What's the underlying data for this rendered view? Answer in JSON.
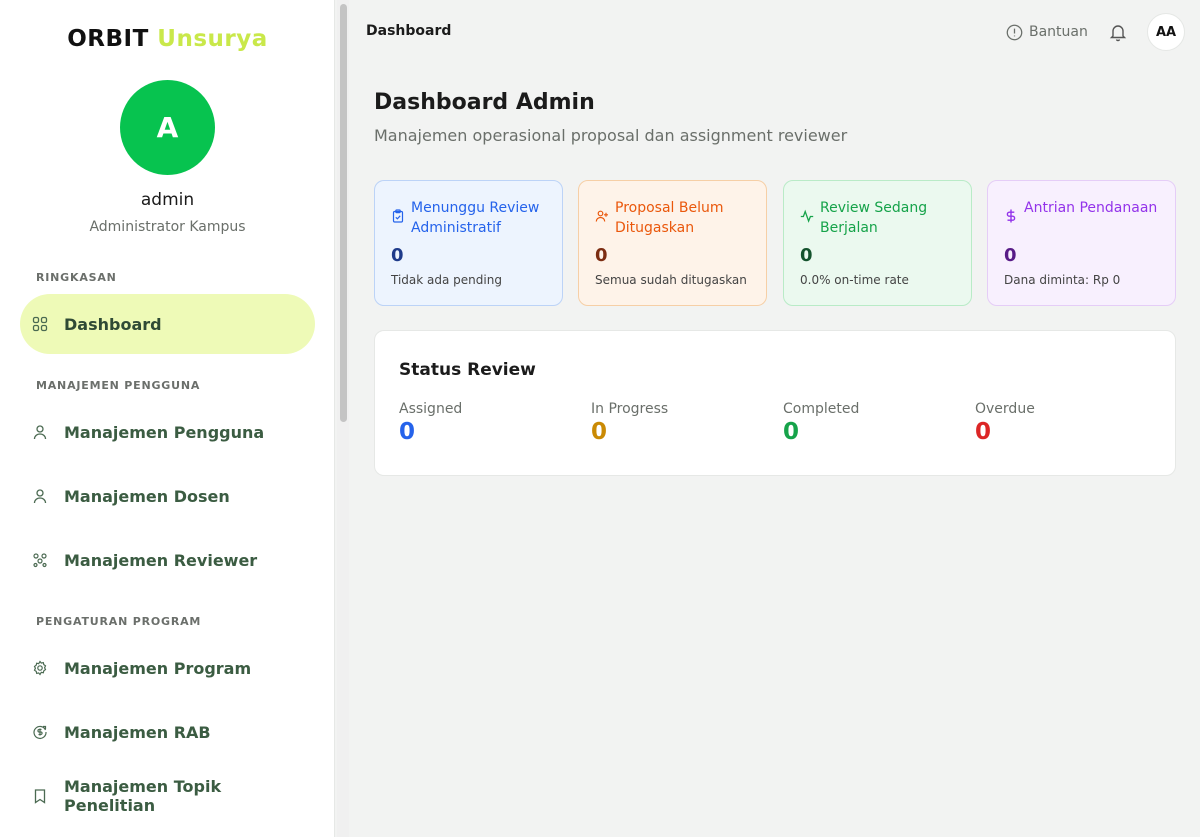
{
  "brand": {
    "part1": "ORBIT",
    "part2": "Unsurya"
  },
  "user": {
    "initial": "A",
    "name": "admin",
    "role": "Administrator Kampus"
  },
  "sidebar": {
    "sections": [
      {
        "label": "RINGKASAN"
      },
      {
        "label": "MANAJEMEN PENGGUNA"
      },
      {
        "label": "PENGATURAN PROGRAM"
      }
    ],
    "items": [
      {
        "label": "Dashboard",
        "icon": "grid-icon",
        "active": true
      },
      {
        "label": "Manajemen Pengguna",
        "icon": "user-icon"
      },
      {
        "label": "Manajemen Dosen",
        "icon": "user-icon"
      },
      {
        "label": "Manajemen Reviewer",
        "icon": "users-network-icon"
      },
      {
        "label": "Manajemen Program",
        "icon": "gear-icon"
      },
      {
        "label": "Manajemen RAB",
        "icon": "money-cycle-icon"
      },
      {
        "label": "Manajemen Topik Penelitian",
        "icon": "bookmark-icon"
      }
    ]
  },
  "topbar": {
    "breadcrumb": "Dashboard",
    "help_label": "Bantuan",
    "user_initials": "AA"
  },
  "main": {
    "title": "Dashboard Admin",
    "subtitle": "Manajemen operasional proposal dan assignment reviewer"
  },
  "cards": [
    {
      "title": "Menunggu Review Administratif",
      "value": "0",
      "desc": "Tidak ada pending",
      "icon": "clipboard-check-icon",
      "color": "#2563eb"
    },
    {
      "title": "Proposal Belum Ditugaskan",
      "value": "0",
      "desc": "Semua sudah ditugaskan",
      "icon": "user-plus-icon",
      "color": "#ea580c"
    },
    {
      "title": "Review Sedang Berjalan",
      "value": "0",
      "desc": "0.0% on-time rate",
      "icon": "activity-icon",
      "color": "#16a34a"
    },
    {
      "title": "Antrian Pendanaan",
      "value": "0",
      "desc": "Dana diminta: Rp 0",
      "icon": "dollar-icon",
      "color": "#9333ea"
    }
  ],
  "status_review": {
    "title": "Status Review",
    "stats": [
      {
        "label": "Assigned",
        "value": "0",
        "color": "#2563eb"
      },
      {
        "label": "In Progress",
        "value": "0",
        "color": "#ca8a04"
      },
      {
        "label": "Completed",
        "value": "0",
        "color": "#16a34a"
      },
      {
        "label": "Overdue",
        "value": "0",
        "color": "#dc2626"
      }
    ]
  }
}
